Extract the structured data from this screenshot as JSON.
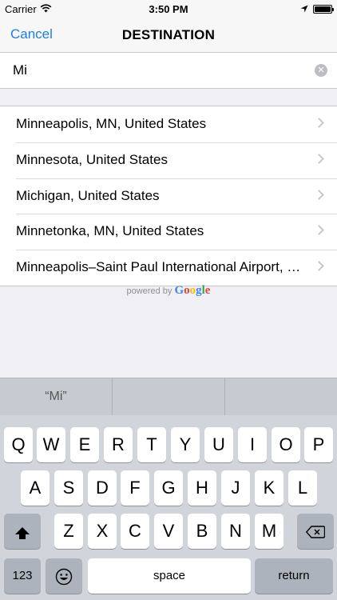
{
  "status_bar": {
    "carrier": "Carrier",
    "time": "3:50 PM",
    "icons": [
      "wifi-icon",
      "location-icon",
      "battery-icon"
    ]
  },
  "nav": {
    "cancel_label": "Cancel",
    "title": "DESTINATION"
  },
  "search": {
    "value": "Mi",
    "clear_icon": "clear-circle-icon"
  },
  "results": [
    {
      "label": "Minneapolis, MN, United States"
    },
    {
      "label": "Minnesota, United States"
    },
    {
      "label": "Michigan, United States"
    },
    {
      "label": "Minnetonka, MN, United States"
    },
    {
      "label": "Minneapolis–Saint Paul International Airport, Saint Paul, MN, United States"
    }
  ],
  "attribution": {
    "prefix": "powered by",
    "brand": "Google"
  },
  "keyboard": {
    "suggestions": [
      "“Mi”",
      "",
      ""
    ],
    "row1": [
      "Q",
      "W",
      "E",
      "R",
      "T",
      "Y",
      "U",
      "I",
      "O",
      "P"
    ],
    "row2": [
      "A",
      "S",
      "D",
      "F",
      "G",
      "H",
      "J",
      "K",
      "L"
    ],
    "row3": [
      "Z",
      "X",
      "C",
      "V",
      "B",
      "N",
      "M"
    ],
    "numbers_label": "123",
    "space_label": "space",
    "return_label": "return",
    "shift_icon": "shift-icon",
    "delete_icon": "delete-icon",
    "emoji_icon": "emoji-icon"
  },
  "colors": {
    "accent": "#1d7fe5",
    "keyboard_bg": "#d1d5db",
    "background": "#efeff4"
  }
}
